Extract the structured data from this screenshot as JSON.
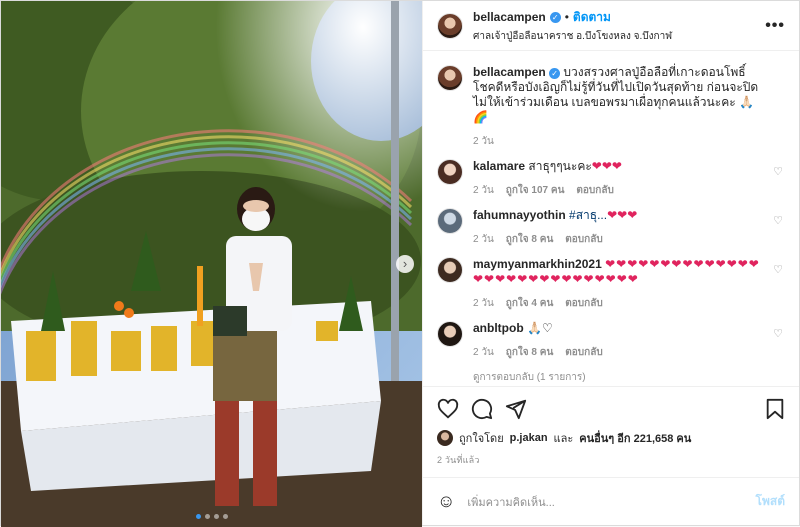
{
  "post": {
    "username": "bellacampen",
    "follow_label": "ติดตาม",
    "location": "ศาลเจ้าปู่อือลือนาคราช อ.บึงโขงหลง จ.บึงกาฬ",
    "more_label": "•••",
    "verified_label": "✓"
  },
  "caption": {
    "username": "bellacampen",
    "text": "บวงสรวงศาลปู่อือลือที่เกาะดอนโพธิ์ โชคดีหรือบังเอิญก็ไม่รู้ที่วันที่ไปเปิดวันสุดท้าย ก่อนจะปิดไม่ให้เข้าร่วมเดือน เบลขอพรมาเผื่อทุกคนแล้วนะคะ 🙏🏻🌈",
    "time": "2 วัน"
  },
  "comments": [
    {
      "username": "kalamare",
      "text": "สาธุๆๆนะคะ",
      "hearts": "❤❤❤",
      "time": "2 วัน",
      "likes": "ถูกใจ 107 คน",
      "reply": "ตอบกลับ"
    },
    {
      "username": "fahumnayyothin",
      "text": "#สาธุ...",
      "hearts": "❤❤❤",
      "time": "2 วัน",
      "likes": "ถูกใจ 8 คน",
      "reply": "ตอบกลับ"
    },
    {
      "username": "maymyanmarkhin2021",
      "text": "",
      "hearts": "❤❤❤❤❤❤❤❤❤❤❤❤❤❤❤❤❤❤❤❤❤❤❤❤❤❤❤❤❤",
      "time": "2 วัน",
      "likes": "ถูกใจ 4 คน",
      "reply": "ตอบกลับ"
    },
    {
      "username": "anbltpob",
      "text": "🙏🏻♡",
      "hearts": "",
      "time": "2 วัน",
      "likes": "ถูกใจ 8 คน",
      "reply": "ตอบกลับ"
    }
  ],
  "view_replies": "ดูการตอบกลับ (1 รายการ)",
  "liked_by": {
    "prefix": "ถูกใจโดย",
    "user": "p.jakan",
    "middle": "และ",
    "others": "คนอื่นๆ อีก 221,658 คน"
  },
  "timestamp": "2 วันที่แล้ว",
  "add_comment": {
    "placeholder": "เพิ่มความคิดเห็น...",
    "post_label": "โพสต์"
  },
  "carousel": {
    "next": "›",
    "count": 4,
    "active_index": 0
  },
  "icons": [
    "heart-icon",
    "comment-icon",
    "share-icon",
    "bookmark-icon",
    "emoji-icon"
  ],
  "colors": {
    "link": "#0095f6",
    "heart": "#e0245e",
    "verified": "#3897f0",
    "muted": "#8e8e8e"
  }
}
